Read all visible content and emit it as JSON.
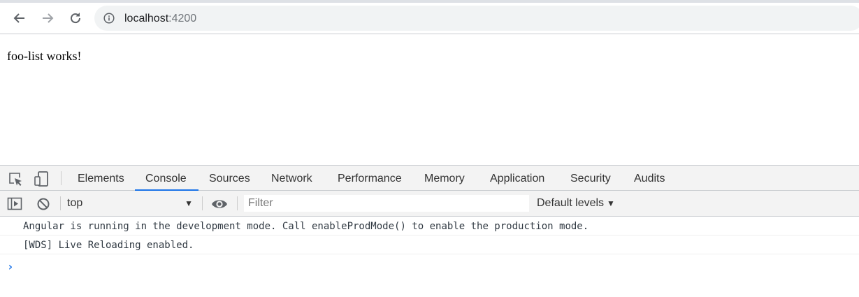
{
  "browser": {
    "url_host": "localhost",
    "url_port": ":4200",
    "icons": {
      "back": "back-arrow-icon",
      "forward": "forward-arrow-icon",
      "reload": "reload-icon",
      "info": "info-icon"
    }
  },
  "page": {
    "text": "foo-list works!"
  },
  "devtools": {
    "tabs": [
      {
        "label": "Elements"
      },
      {
        "label": "Console",
        "active": true
      },
      {
        "label": "Sources"
      },
      {
        "label": "Network"
      },
      {
        "label": "Performance"
      },
      {
        "label": "Memory"
      },
      {
        "label": "Application"
      },
      {
        "label": "Security"
      },
      {
        "label": "Audits"
      }
    ],
    "console_bar": {
      "context": "top",
      "filter_placeholder": "Filter",
      "levels": "Default levels"
    },
    "messages": [
      "Angular is running in the development mode. Call enableProdMode() to enable the production mode.",
      "[WDS] Live Reloading enabled."
    ],
    "prompt": "›",
    "accent_color": "#1a73e8"
  }
}
